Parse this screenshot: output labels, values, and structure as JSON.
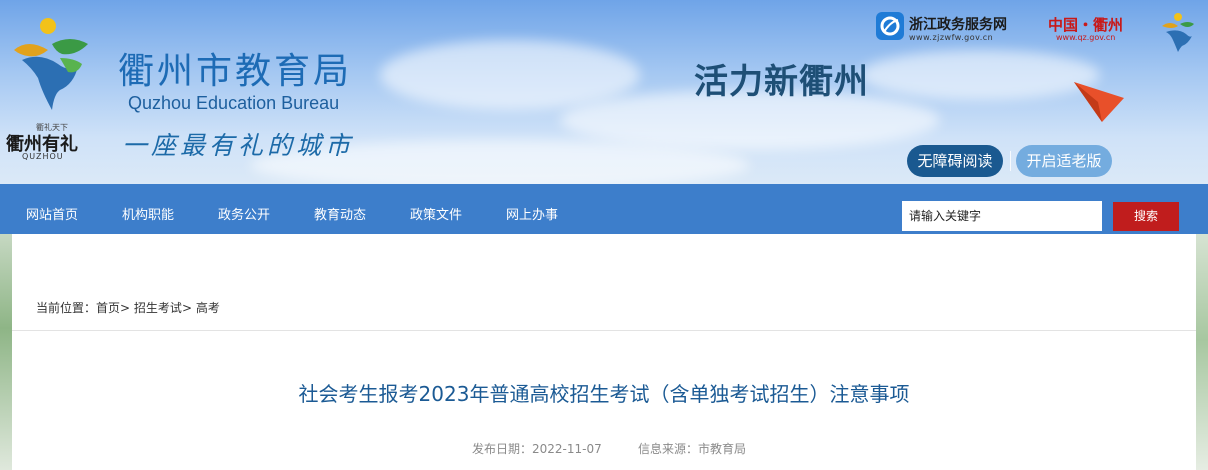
{
  "header": {
    "logo": {
      "slogan_small": "衢礼天下",
      "city_name": "衢州有礼",
      "city_en": "QUZHOU"
    },
    "title_cn": "衢州市教育局",
    "title_en": "Quzhou Education Bureau",
    "motto": "一座最有礼的城市",
    "vitality_slogan": "活力新衢州",
    "zj_service": {
      "name": "浙江政务服务网",
      "url": "www.zjzwfw.gov.cn"
    },
    "qz_portal": {
      "name": "中国・衢州",
      "url": "www.qz.gov.cn"
    },
    "accessible_label": "无障碍阅读",
    "elder_label": "开启适老版"
  },
  "nav": {
    "items": [
      "网站首页",
      "机构职能",
      "政务公开",
      "教育动态",
      "政策文件",
      "网上办事"
    ],
    "search_placeholder": "请输入关键字",
    "search_button": "搜索"
  },
  "breadcrumb": {
    "prefix": "当前位置：",
    "home": "首页",
    "section": "招生考试",
    "current": "高考",
    "sep": ">"
  },
  "article": {
    "title": "社会考生报考2023年普通高校招生考试（含单独考试招生）注意事项",
    "date_label": "发布日期：2022-11-07",
    "source_label": "信息来源：市教育局"
  },
  "colors": {
    "nav_bg": "#3d7ecb",
    "search_button": "#c01d1d",
    "title": "#1b5a94",
    "accessible_pill": "#1a5990",
    "elder_pill": "#74acdf"
  }
}
